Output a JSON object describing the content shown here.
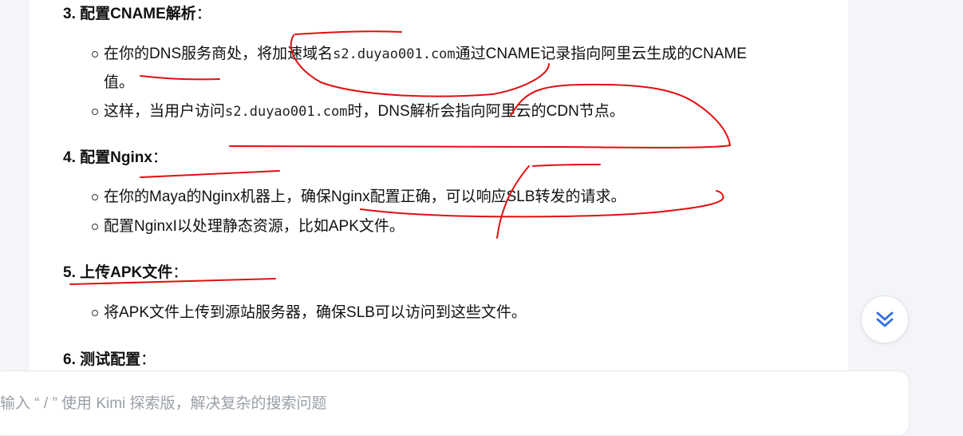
{
  "sections": [
    {
      "title": "3. 配置CNAME解析",
      "items": [
        {
          "before": "在你的DNS服务商处，将加速域名",
          "code": "s2.duyao001.com",
          "after": "通过CNAME记录指向阿里云生成的CNAME",
          "line2": "值。"
        },
        {
          "before": "这样，当用户访问",
          "code": "s2.duyao001.com",
          "after": "时，DNS解析会指向阿里云的CDN节点。"
        }
      ]
    },
    {
      "title": "4. 配置Nginx",
      "items": [
        {
          "text": "在你的Maya的Nginx机器上，确保Nginx配置正确，可以响应SLB转发的请求。"
        },
        {
          "text": "配置NginxI以处理静态资源，比如APK文件。"
        }
      ]
    },
    {
      "title": "5. 上传APK文件",
      "items": [
        {
          "text": "将APK文件上传到源站服务器，确保SLB可以访问到这些文件。"
        }
      ]
    },
    {
      "title": "6. 测试配置",
      "items": []
    }
  ],
  "colon": "：",
  "input": {
    "placeholder": "输入 “ / ” 使用 Kimi 探索版，解决复杂的搜索问题"
  },
  "icons": {
    "scroll": "chevron-double-down-icon"
  },
  "colors": {
    "accent": "#2b6de8",
    "annotation": "#e01010",
    "text": "#111111"
  }
}
